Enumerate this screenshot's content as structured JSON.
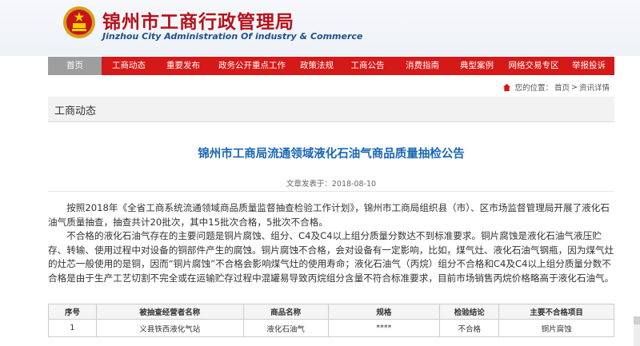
{
  "header": {
    "title": "锦州市工商行政管理局",
    "subtitle": "Jinzhou City Administration Of industry & Commerce"
  },
  "nav": {
    "items": [
      "首页",
      "工商动态",
      "重要发布",
      "政务公开重点工作",
      "政策法规",
      "工商公告",
      "消费指南",
      "典型案例",
      "网络交易专区",
      "举报投诉"
    ]
  },
  "breadcrumb": {
    "prefix": "您的位置：",
    "items": [
      "首页",
      "资讯详情"
    ],
    "separator": ">"
  },
  "section": {
    "title": "工商动态"
  },
  "article": {
    "title": "锦州市工商局流通领域液化石油气商品质量抽检公告",
    "pub_label": "文章发表于：",
    "pub_date": "2018-08-10",
    "paragraphs": [
      "按照2018年《全省工商系统流通领域商品质量监督抽查检验工作计划》，锦州市工商局组织县（市）、区市场监督管理局开展了液化石油气质量抽查，抽查共计20批次，其中15批次合格，5批次不合格。",
      "不合格的液化石油气存在的主要问题是铜片腐蚀、组分、C4及C4以上组分质量分数达不到标准要求。铜片腐蚀是液化石油气液压贮存、转输、使用过程中对设备的铜部件产生的腐蚀。铜片腐蚀不合格，会对设备有一定影响，比如，煤气灶、液化石油气钢瓶，因为煤气灶的灶芯一般使用的是铜，因而“铜片腐蚀”不合格会影响煤气灶的使用寿命；液化石油气（丙烷）组分不合格和C4及C4以上组分质量分数不合格是由于生产工艺切割不完全或在运输贮存过程中混罐易导致丙烷组分含量不符合标准要求，目前市场销售丙烷价格略高于液化石油气。"
    ]
  },
  "table": {
    "headers": [
      "序号",
      "被抽查经营者名称",
      "商品名称",
      "规格",
      "检验结论",
      "主要不合格项目"
    ],
    "rows": [
      [
        "1",
        "义县铁西液化气站",
        "液化石油气",
        "****",
        "不合格",
        "铜片腐蚀"
      ]
    ]
  },
  "colors": {
    "nav_bg": "#d51818",
    "nav_active": "#9e9e9e",
    "title_red": "#b5121b",
    "article_title_blue": "#1a67b5",
    "subtitle_blue": "#1f4f8f"
  }
}
